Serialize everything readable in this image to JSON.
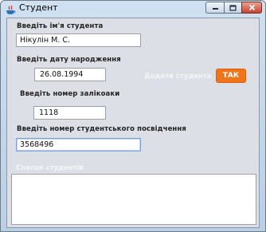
{
  "window": {
    "title": "Студент",
    "controls": {
      "minimize_icon": "minimize-icon",
      "maximize_icon": "maximize-icon",
      "close_icon": "close-icon"
    }
  },
  "form": {
    "name_label": "Введіть ім'я студента",
    "name_value": "Нікулін М. С.",
    "birth_label": "Введіть дату народження",
    "birth_value": "26.08.1994",
    "record_label": "Введіть номер залікоаки",
    "record_value": "1118",
    "id_label": "Введіть номер студентського посвідчення",
    "id_value": "3568496",
    "add_label": "Додати студента",
    "ok_button": "ТАК",
    "list_caption": "Список студентів"
  },
  "colors": {
    "accent": "#f0741a",
    "panel": "#dcdfe6"
  }
}
